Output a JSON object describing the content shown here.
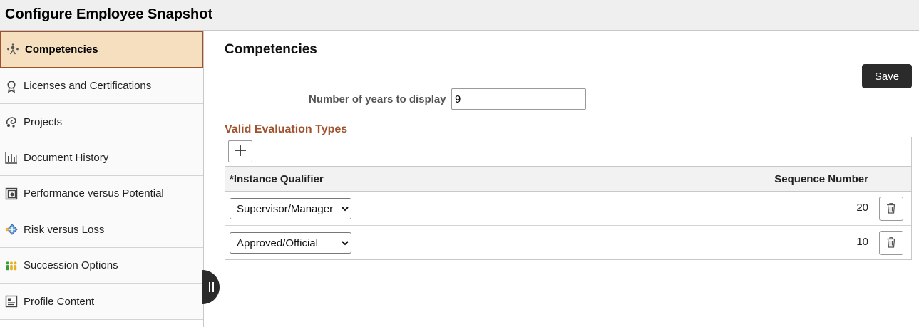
{
  "header": {
    "title": "Configure Employee Snapshot"
  },
  "sidebar": {
    "items": [
      {
        "label": "Competencies",
        "icon": "competencies-icon",
        "selected": true
      },
      {
        "label": "Licenses and Certifications",
        "icon": "ribbon-icon",
        "selected": false
      },
      {
        "label": "Projects",
        "icon": "projects-icon",
        "selected": false
      },
      {
        "label": "Document History",
        "icon": "bar-chart-icon",
        "selected": false
      },
      {
        "label": "Performance versus Potential",
        "icon": "performance-icon",
        "selected": false
      },
      {
        "label": "Risk versus Loss",
        "icon": "risk-icon",
        "selected": false
      },
      {
        "label": "Succession Options",
        "icon": "succession-icon",
        "selected": false
      },
      {
        "label": "Profile Content",
        "icon": "profile-content-icon",
        "selected": false
      }
    ]
  },
  "main": {
    "title": "Competencies",
    "save_label": "Save",
    "years_label": "Number of years to display",
    "years_value": "9",
    "section_title": "Valid Evaluation Types",
    "grid": {
      "columns": [
        "*Instance Qualifier",
        "Sequence Number"
      ],
      "rows": [
        {
          "qualifier": "Supervisor/Manager",
          "sequence": "20"
        },
        {
          "qualifier": "Approved/Official",
          "sequence": "10"
        }
      ]
    }
  },
  "colors": {
    "accent": "#a0522d",
    "selected_bg": "#f5dfbf",
    "button_dark": "#2b2b2b"
  }
}
